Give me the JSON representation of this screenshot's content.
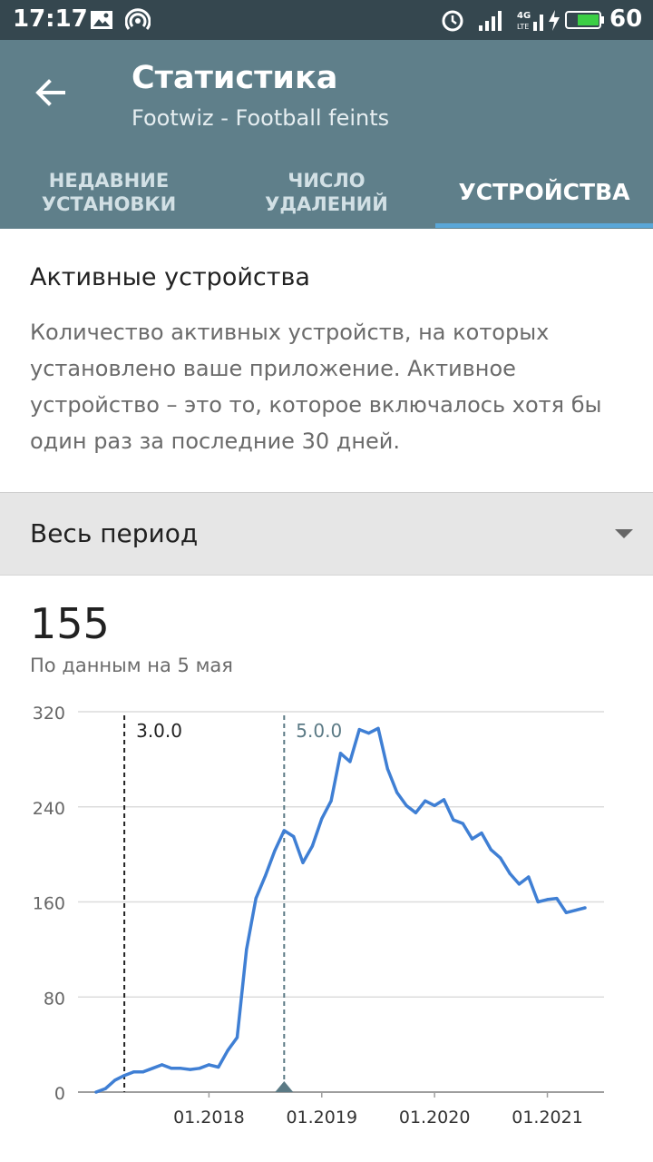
{
  "status_bar": {
    "time": "17:17",
    "battery": "60",
    "icons": [
      "image-icon",
      "hotspot-icon",
      "alarm-icon",
      "signal-icon",
      "lte-icon",
      "charging-icon",
      "battery-icon"
    ]
  },
  "app_bar": {
    "title": "Статистика",
    "subtitle": "Footwiz - Football feints",
    "back_icon": "arrow-left-icon"
  },
  "tabs": [
    {
      "label": "НЕДАВНИЕ УСТАНОВКИ",
      "active": false
    },
    {
      "label": "ЧИСЛО УДАЛЕНИЙ",
      "active": false
    },
    {
      "label": "УСТРОЙСТВА",
      "active": true
    }
  ],
  "card": {
    "title": "Активные устройства",
    "description": "Количество активных устройств, на которых установлено ваше приложение. Активное устройство – это то, которое включалось хотя бы один раз за последние 30 дней."
  },
  "period": {
    "selected": "Весь период"
  },
  "summary": {
    "value": "155",
    "as_of": "По данным на 5 мая"
  },
  "colors": {
    "app_bar": "#5f7f8a",
    "status_bar": "#35474f",
    "accent": "#5aa7d8",
    "line": "#3f7fd4",
    "marker_50": "#5b7a85"
  },
  "chart_data": {
    "type": "line",
    "ylim": [
      0,
      320
    ],
    "yticks": [
      0,
      80,
      160,
      240,
      320
    ],
    "xticks": [
      "01.2018",
      "01.2019",
      "01.2020",
      "01.2021"
    ],
    "x_range": [
      "2017-01",
      "2021-05"
    ],
    "series": [
      {
        "x": [
          "2017-01",
          "2017-02",
          "2017-03",
          "2017-04",
          "2017-05",
          "2017-06",
          "2017-07",
          "2017-08",
          "2017-09",
          "2017-10",
          "2017-11",
          "2017-12",
          "2018-01",
          "2018-02",
          "2018-03",
          "2018-04",
          "2018-05",
          "2018-06",
          "2018-07",
          "2018-08",
          "2018-09",
          "2018-10",
          "2018-11",
          "2018-12",
          "2019-01",
          "2019-02",
          "2019-03",
          "2019-04",
          "2019-05",
          "2019-06",
          "2019-07",
          "2019-08",
          "2019-09",
          "2019-10",
          "2019-11",
          "2019-12",
          "2020-01",
          "2020-02",
          "2020-03",
          "2020-04",
          "2020-05",
          "2020-06",
          "2020-07",
          "2020-08",
          "2020-09",
          "2020-10",
          "2020-11",
          "2020-12",
          "2021-01",
          "2021-02",
          "2021-03",
          "2021-04",
          "2021-05"
        ],
        "values": [
          0,
          3,
          10,
          14,
          17,
          17,
          20,
          23,
          20,
          20,
          19,
          20,
          23,
          21,
          35,
          46,
          120,
          163,
          182,
          203,
          220,
          215,
          193,
          207,
          230,
          245,
          285,
          278,
          305,
          302,
          306,
          272,
          252,
          241,
          235,
          245,
          241,
          246,
          229,
          226,
          213,
          218,
          204,
          197,
          184,
          175,
          181,
          160,
          162,
          163,
          151,
          153,
          155
        ]
      }
    ],
    "annotations": [
      {
        "label": "3.0.0",
        "x": "2017-04"
      },
      {
        "label": "5.0.0",
        "x": "2018-09"
      }
    ]
  }
}
